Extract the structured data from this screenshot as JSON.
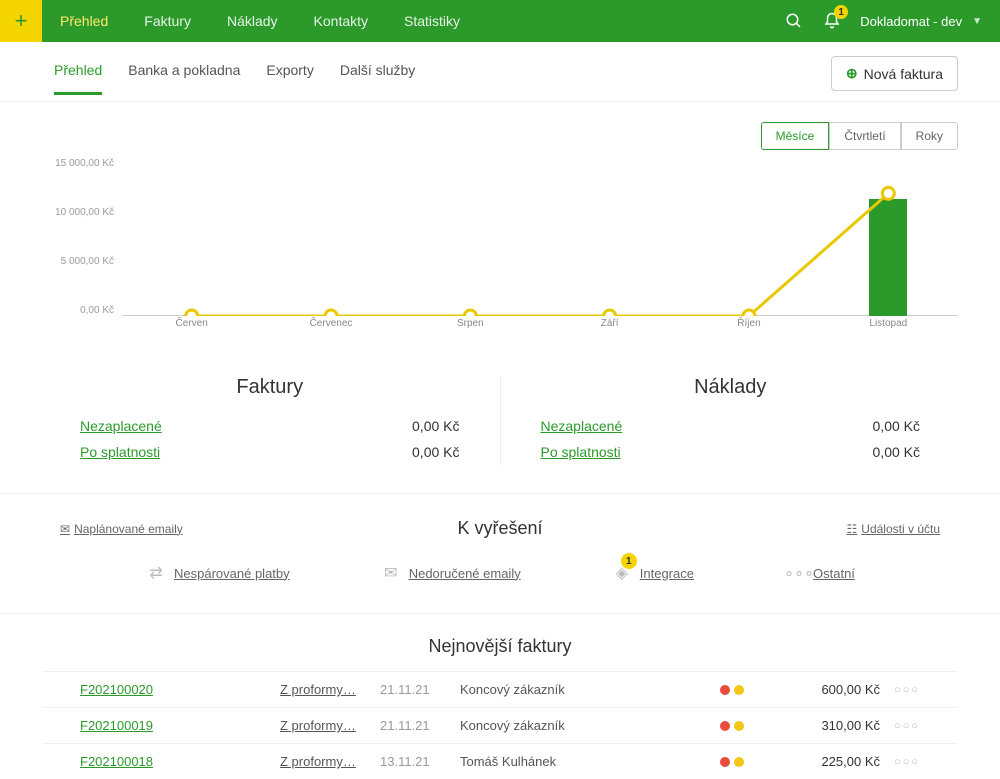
{
  "topbar": {
    "nav": [
      "Přehled",
      "Faktury",
      "Náklady",
      "Kontakty",
      "Statistiky"
    ],
    "active_index": 0,
    "notifications": "1",
    "account": "Dokladomat - dev"
  },
  "subnav": {
    "items": [
      "Přehled",
      "Banka a pokladna",
      "Exporty",
      "Další služby"
    ],
    "active_index": 0,
    "new_invoice": "Nová faktura"
  },
  "period_toggle": {
    "items": [
      "Měsíce",
      "Čtvrtletí",
      "Roky"
    ],
    "active_index": 0
  },
  "chart_data": {
    "type": "bar+line",
    "categories": [
      "Červen",
      "Červenec",
      "Srpen",
      "Září",
      "Říjen",
      "Listopad"
    ],
    "bar_values": [
      0,
      0,
      0,
      0,
      0,
      11000
    ],
    "line_values": [
      0,
      0,
      0,
      0,
      0,
      11500
    ],
    "y_ticks": [
      "15 000,00 Kč",
      "10 000,00 Kč",
      "5 000,00 Kč",
      "0,00 Kč"
    ],
    "ylim": [
      0,
      15000
    ],
    "y_unit": "Kč"
  },
  "summary": {
    "left": {
      "title": "Faktury",
      "rows": [
        {
          "label": "Nezaplacené",
          "value": "0,00 Kč"
        },
        {
          "label": "Po splatnosti",
          "value": "0,00 Kč"
        }
      ]
    },
    "right": {
      "title": "Náklady",
      "rows": [
        {
          "label": "Nezaplacené",
          "value": "0,00 Kč"
        },
        {
          "label": "Po splatnosti",
          "value": "0,00 Kč"
        }
      ]
    }
  },
  "resolve": {
    "title": "K vyřešení",
    "left_link": "Naplánované emaily",
    "right_link": "Události v účtu",
    "items": [
      {
        "label": "Nespárované platby"
      },
      {
        "label": "Nedoručené emaily"
      },
      {
        "label": "Integrace",
        "badge": "1"
      },
      {
        "label": "Ostatní"
      }
    ]
  },
  "invoices": {
    "title": "Nejnovější faktury",
    "rows": [
      {
        "num": "F202100020",
        "type": "Z proformy…",
        "date": "21.11.21",
        "customer": "Koncový zákazník",
        "amount": "600,00 Kč"
      },
      {
        "num": "F202100019",
        "type": "Z proformy…",
        "date": "21.11.21",
        "customer": "Koncový zákazník",
        "amount": "310,00 Kč"
      },
      {
        "num": "F202100018",
        "type": "Z proformy…",
        "date": "13.11.21",
        "customer": "Tomáš Kulhánek",
        "amount": "225,00 Kč"
      }
    ]
  }
}
